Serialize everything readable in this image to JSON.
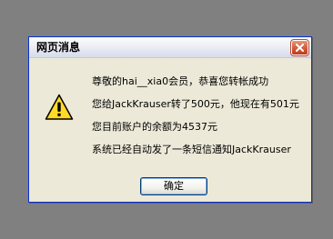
{
  "dialog": {
    "title": "网页消息",
    "close_icon": "close-x-icon",
    "warning_icon": "warning-triangle-icon",
    "messages": [
      "尊敬的hai__xia0会员，恭喜您转帐成功",
      "您给JackKrauser转了500元，他现在有501元",
      "您目前账户的余额为4537元",
      "系统已经自动发了一条短信通知JackKrauser"
    ],
    "ok_label": "确定"
  },
  "colors": {
    "background": "#808080",
    "dialog_face": "#ECE9D8",
    "close_button": "#D1603E",
    "warning_yellow": "#FFD200"
  }
}
